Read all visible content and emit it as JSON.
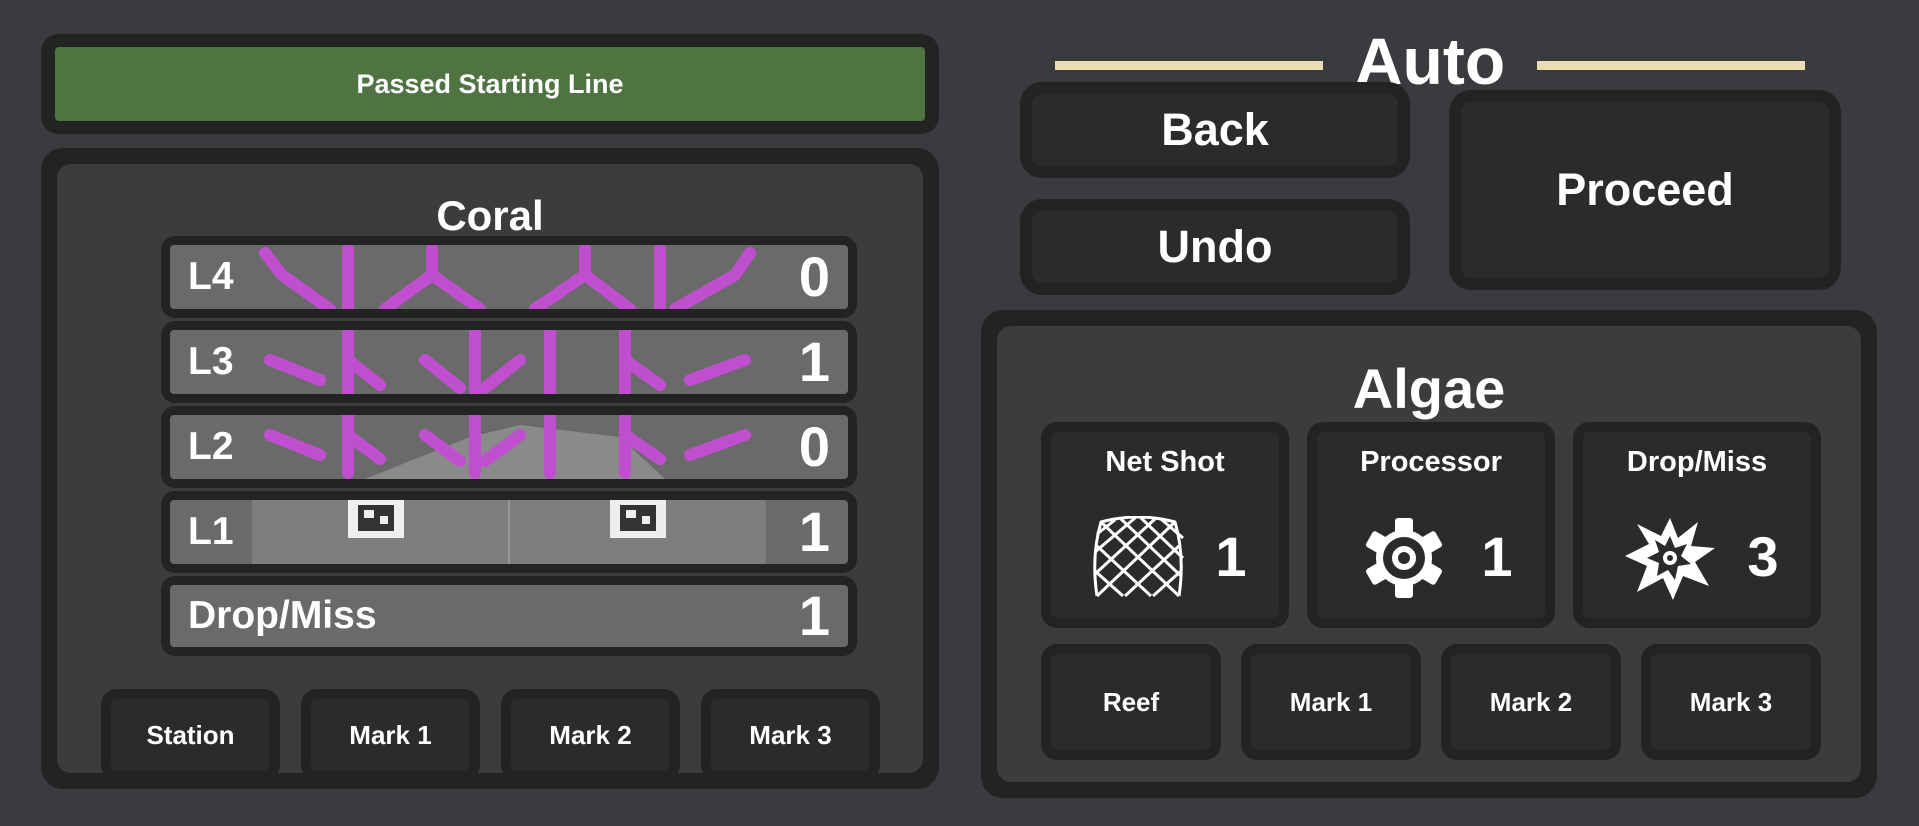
{
  "starting_line": {
    "label": "Passed Starting Line",
    "color": "#4f7441"
  },
  "coral": {
    "title": "Coral",
    "levels": [
      {
        "label": "L4",
        "count": "0"
      },
      {
        "label": "L3",
        "count": "1"
      },
      {
        "label": "L2",
        "count": "0"
      },
      {
        "label": "L1",
        "count": "1"
      },
      {
        "label": "Drop/Miss",
        "count": "1"
      }
    ],
    "marks": [
      "Station",
      "Mark 1",
      "Mark 2",
      "Mark 3"
    ],
    "branch_color": "#c04fd0"
  },
  "header": {
    "title": "Auto",
    "line_color": "#eadcb3"
  },
  "nav": {
    "back": "Back",
    "undo": "Undo",
    "proceed": "Proceed"
  },
  "algae": {
    "title": "Algae",
    "cards": [
      {
        "label": "Net Shot",
        "count": "1",
        "icon": "net-icon"
      },
      {
        "label": "Processor",
        "count": "1",
        "icon": "gear-icon"
      },
      {
        "label": "Drop/Miss",
        "count": "3",
        "icon": "burst-icon"
      }
    ],
    "marks": [
      "Reef",
      "Mark 1",
      "Mark 2",
      "Mark 3"
    ]
  }
}
